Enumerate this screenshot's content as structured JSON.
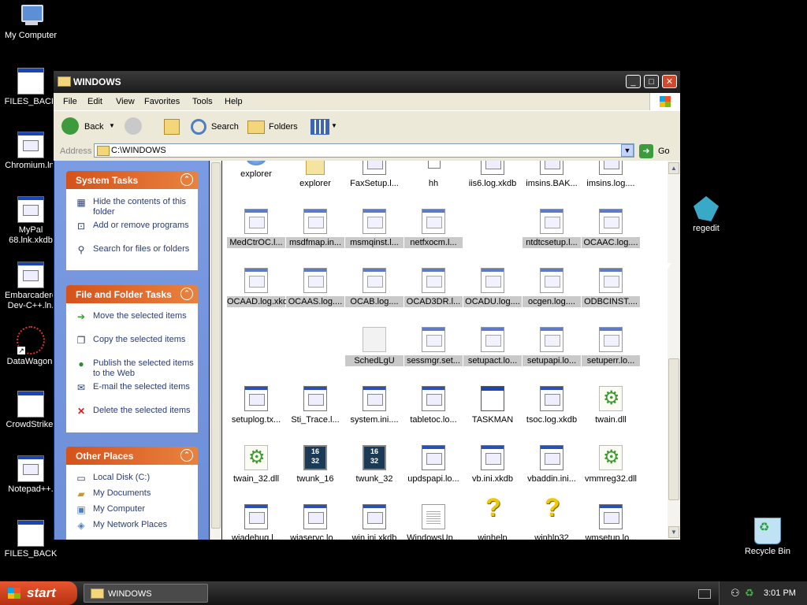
{
  "desktop": {
    "icons": [
      {
        "label": "My Computer"
      },
      {
        "label": "FILES_BACK"
      },
      {
        "label": "Chromium.ln."
      },
      {
        "label": "MyPal 68.lnk.xkdb"
      },
      {
        "label": "Embarcadero Dev-C++.ln."
      },
      {
        "label": "DataWagon."
      },
      {
        "label": "CrowdStrike."
      },
      {
        "label": "Notepad++."
      },
      {
        "label": "FILES_BACK"
      },
      {
        "label": "regedit"
      },
      {
        "label": "Recycle Bin"
      }
    ]
  },
  "window": {
    "title": "WINDOWS",
    "controls": {
      "minimize": "_",
      "maximize": "□",
      "close": "✕"
    }
  },
  "menu": [
    "File",
    "Edit",
    "View",
    "Favorites",
    "Tools",
    "Help"
  ],
  "toolbar": {
    "back": "Back",
    "search": "Search",
    "folders": "Folders"
  },
  "address": {
    "label": "Address",
    "value": "C:\\WINDOWS",
    "go": "Go"
  },
  "tasks": {
    "system": {
      "title": "System Tasks",
      "items": [
        "Hide the contents of this folder",
        "Add or remove programs",
        "Search for files or folders"
      ]
    },
    "file_folder": {
      "title": "File and Folder Tasks",
      "items": [
        "Move the selected items",
        "Copy the selected items",
        "Publish the selected items to the Web",
        "E-mail the selected items",
        "Delete the selected items"
      ]
    },
    "other": {
      "title": "Other Places",
      "items": [
        "Local Disk (C:)",
        "My Documents",
        "My Computer",
        "My Network Places"
      ]
    }
  },
  "files": [
    {
      "name": "explorer",
      "type": "expl",
      "selected": false
    },
    {
      "name": "explorer",
      "type": "expl2",
      "selected": false
    },
    {
      "name": "FaxSetup.l...",
      "type": "log",
      "selected": false
    },
    {
      "name": "hh",
      "type": "hh",
      "selected": false
    },
    {
      "name": "iis6.log.xkdb",
      "type": "log",
      "selected": false
    },
    {
      "name": "imsins.BAK...",
      "type": "log",
      "selected": false
    },
    {
      "name": "imsins.log....",
      "type": "log",
      "selected": false
    },
    {
      "name": "MedCtrOC.l...",
      "type": "log",
      "selected": true
    },
    {
      "name": "msdfmap.in...",
      "type": "log",
      "selected": true
    },
    {
      "name": "msmqinst.l...",
      "type": "log",
      "selected": true
    },
    {
      "name": "netfxocm.l...",
      "type": "log",
      "selected": true
    },
    {
      "name": "",
      "type": "none",
      "selected": false
    },
    {
      "name": "ntdtcsetup.l...",
      "type": "log",
      "selected": true
    },
    {
      "name": "OCAAC.log....",
      "type": "log",
      "selected": true
    },
    {
      "name": "OCAAD.log.xkdb",
      "type": "log",
      "selected": true
    },
    {
      "name": "OCAAS.log....",
      "type": "log",
      "selected": true
    },
    {
      "name": "OCAB.log....",
      "type": "log",
      "selected": true
    },
    {
      "name": "OCAD3DR.l...",
      "type": "log",
      "selected": true
    },
    {
      "name": "OCADU.log....",
      "type": "log",
      "selected": true
    },
    {
      "name": "ocgen.log....",
      "type": "log",
      "selected": true
    },
    {
      "name": "ODBCINST....",
      "type": "log",
      "selected": true
    },
    {
      "name": "",
      "type": "none",
      "selected": false
    },
    {
      "name": "",
      "type": "none",
      "selected": false
    },
    {
      "name": "SchedLgU",
      "type": "sched",
      "selected": true
    },
    {
      "name": "sessmgr.set...",
      "type": "log",
      "selected": true
    },
    {
      "name": "setupact.lo...",
      "type": "log",
      "selected": true
    },
    {
      "name": "setupapi.lo...",
      "type": "log",
      "selected": true
    },
    {
      "name": "setuperr.lo...",
      "type": "log",
      "selected": true
    },
    {
      "name": "setuplog.tx...",
      "type": "log",
      "selected": false
    },
    {
      "name": "Sti_Trace.l...",
      "type": "log",
      "selected": false
    },
    {
      "name": "system.ini....",
      "type": "log",
      "selected": false
    },
    {
      "name": "tabletoc.lo...",
      "type": "log",
      "selected": false
    },
    {
      "name": "TASKMAN",
      "type": "exe",
      "selected": false
    },
    {
      "name": "tsoc.log.xkdb",
      "type": "log",
      "selected": false
    },
    {
      "name": "twain.dll",
      "type": "dll",
      "selected": false
    },
    {
      "name": "twain_32.dll",
      "type": "dll",
      "selected": false
    },
    {
      "name": "twunk_16",
      "type": "w16",
      "selected": false
    },
    {
      "name": "twunk_32",
      "type": "w16",
      "selected": false
    },
    {
      "name": "updspapi.lo...",
      "type": "log",
      "selected": false
    },
    {
      "name": "vb.ini.xkdb",
      "type": "log",
      "selected": false
    },
    {
      "name": "vbaddin.ini...",
      "type": "log",
      "selected": false
    },
    {
      "name": "vmmreg32.dll",
      "type": "dll",
      "selected": false
    },
    {
      "name": "wiadebug.l...",
      "type": "log",
      "selected": false
    },
    {
      "name": "wiaservc.lo...",
      "type": "log",
      "selected": false
    },
    {
      "name": "win.ini.xkdb",
      "type": "log",
      "selected": false
    },
    {
      "name": "WindowsUp...",
      "type": "txt",
      "selected": false
    },
    {
      "name": "winhelp",
      "type": "help",
      "selected": false
    },
    {
      "name": "winhlp32",
      "type": "help",
      "selected": false
    },
    {
      "name": "wmsetup.lo...",
      "type": "log",
      "selected": false
    }
  ],
  "taskbar": {
    "start": "start",
    "task": "WINDOWS",
    "clock": "3:01 PM"
  }
}
